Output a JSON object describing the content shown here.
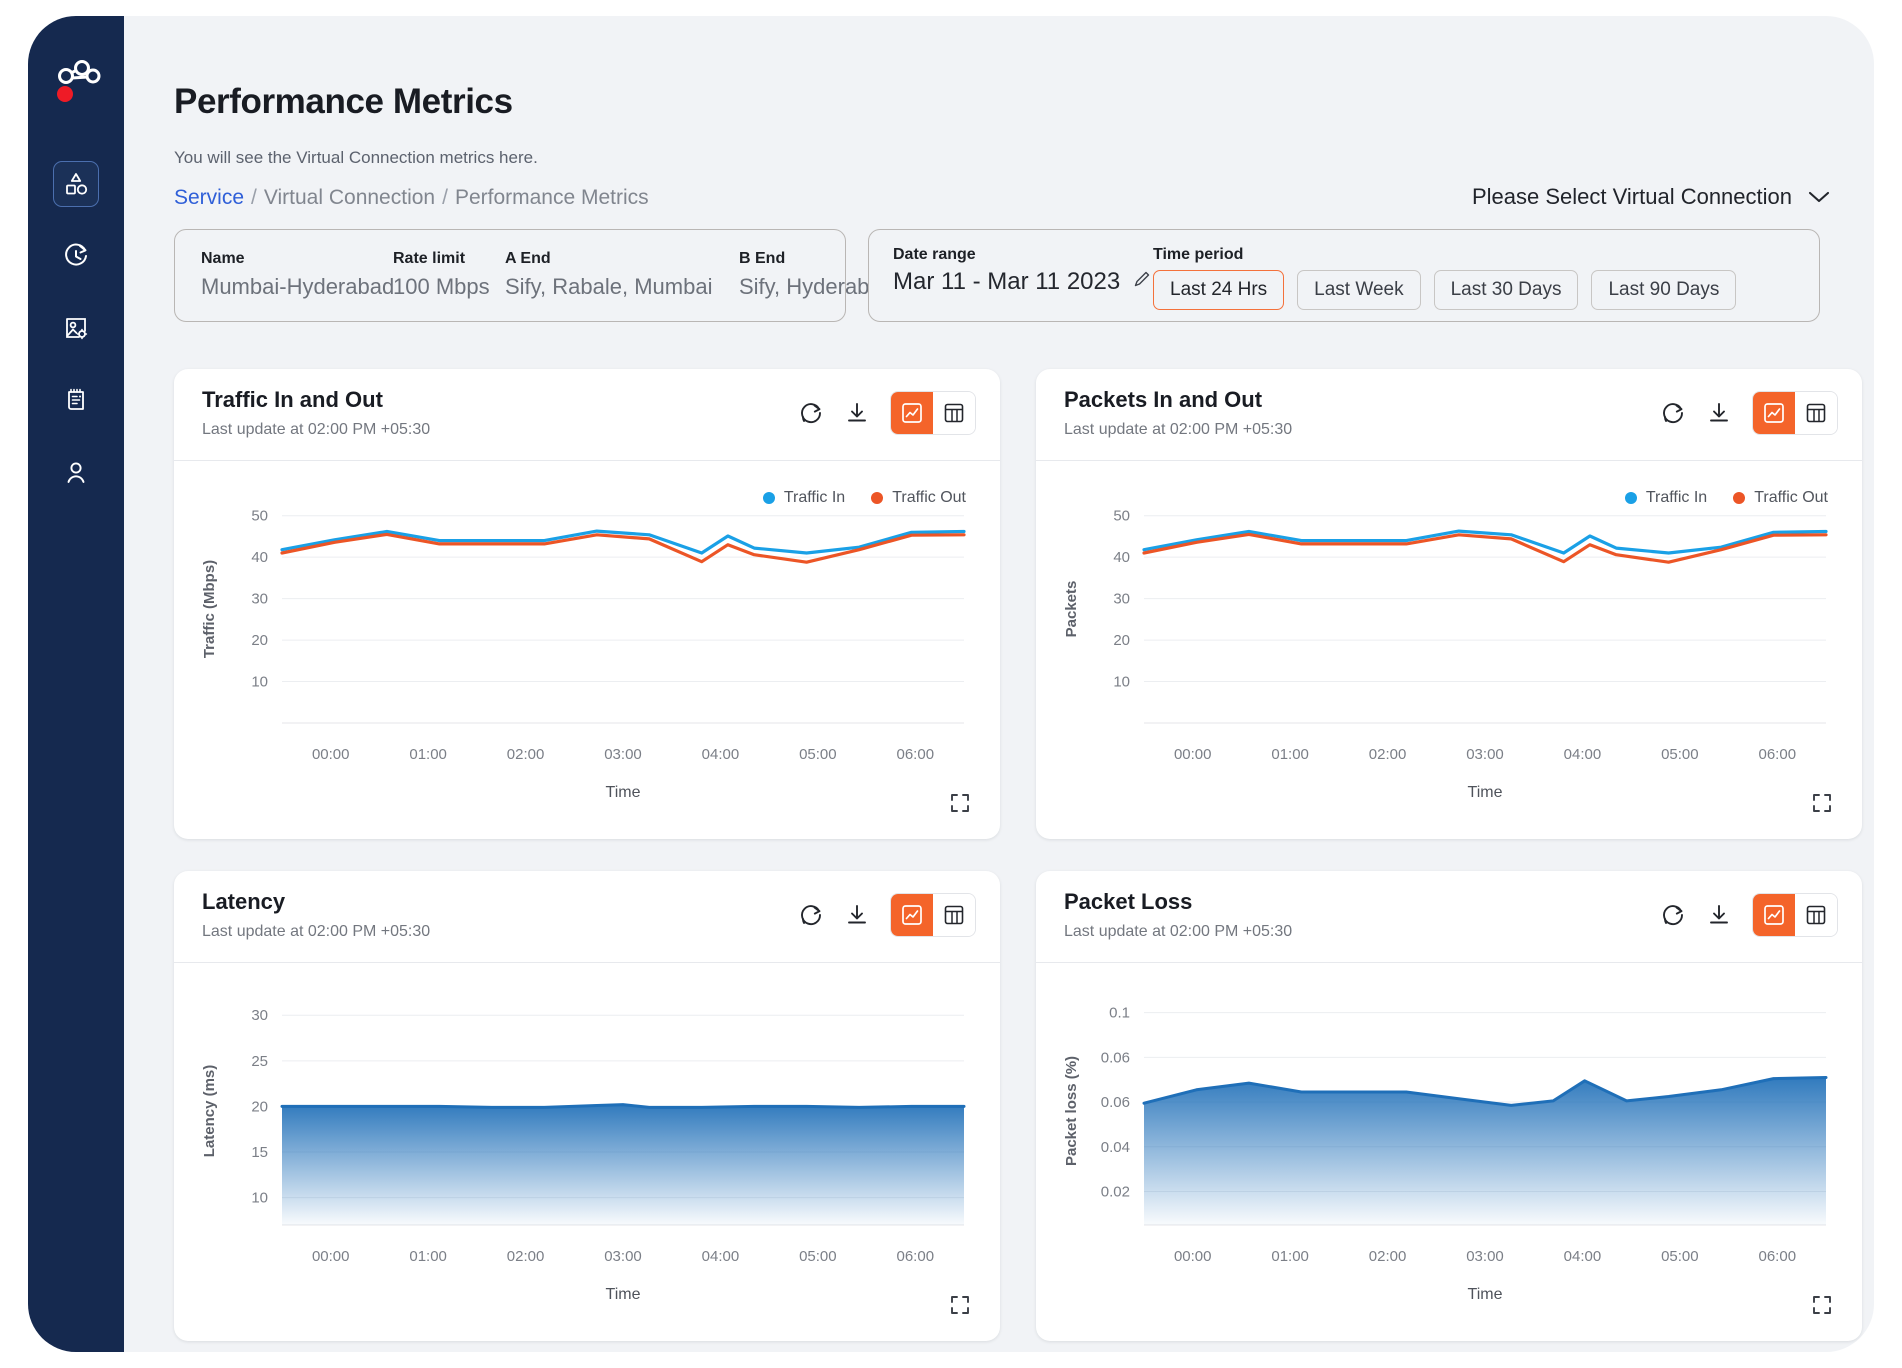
{
  "header": {
    "title": "Performance Metrics",
    "subtitle": "You will see the Virtual Connection metrics here.",
    "breadcrumb": {
      "link": "Service",
      "sep1": "/",
      "middle": "Virtual Connection",
      "sep2": "/",
      "current": "Performance Metrics"
    },
    "vc_selector_label": "Please Select Virtual Connection",
    "vc_selector_icon": "chevron-down-icon"
  },
  "sidebar": {
    "logo_icon": "network-nodes-logo",
    "items": [
      {
        "icon": "shapes-dashboard-icon",
        "active": true
      },
      {
        "icon": "clock-history-icon",
        "active": false
      },
      {
        "icon": "image-settings-icon",
        "active": false
      },
      {
        "icon": "invoice-document-icon",
        "active": false
      },
      {
        "icon": "user-profile-icon",
        "active": false
      }
    ]
  },
  "info_panel": {
    "fields": [
      {
        "label": "Name",
        "value": "Mumbai-Hyderabad"
      },
      {
        "label": "Rate limit",
        "value": "100 Mbps"
      },
      {
        "label": "A End",
        "value": "Sify, Rabale, Mumbai"
      },
      {
        "label": "B End",
        "value": "Sify, Hyderabad"
      }
    ]
  },
  "range_panel": {
    "date_range_label": "Date range",
    "date_range_value": "Mar 11 - Mar 11 2023",
    "edit_icon": "pencil-edit-icon",
    "time_period_label": "Time period",
    "periods": [
      {
        "label": "Last 24 Hrs",
        "selected": true
      },
      {
        "label": "Last Week",
        "selected": false
      },
      {
        "label": "Last 30 Days",
        "selected": false
      },
      {
        "label": "Last 90 Days",
        "selected": false
      }
    ]
  },
  "card_tools": {
    "refresh_icon": "refresh-icon",
    "download_icon": "download-icon",
    "chart_view_icon": "line-chart-icon",
    "table_view_icon": "table-grid-icon",
    "expand_icon": "expand-fullscreen-icon"
  },
  "colors": {
    "accent": "#f4642a",
    "traffic_in": "#1aa0e6",
    "traffic_out": "#ec5526",
    "area_line": "#1f6fb8",
    "sidebar": "#15294f",
    "link": "#2f5fd8"
  },
  "cards": [
    {
      "title": "Traffic In and Out",
      "subtitle": "Last update at 02:00 PM +05:30"
    },
    {
      "title": "Packets In and Out",
      "subtitle": "Last update at 02:00 PM +05:30"
    },
    {
      "title": "Latency",
      "subtitle": "Last update at 02:00 PM +05:30"
    },
    {
      "title": "Packet Loss",
      "subtitle": "Last update at 02:00 PM +05:30"
    }
  ],
  "chart_data": [
    {
      "id": "traffic",
      "type": "line",
      "title": "Traffic In and Out",
      "xlabel": "Time",
      "ylabel": "Traffic (Mbps)",
      "xticks": [
        "00:00",
        "01:00",
        "02:00",
        "03:00",
        "04:00",
        "05:00",
        "06:00"
      ],
      "yticks": [
        10,
        20,
        30,
        40,
        50
      ],
      "ylim": [
        0,
        55
      ],
      "grid": true,
      "legend_position": "top-right",
      "legend": [
        "Traffic In",
        "Traffic Out"
      ],
      "x": [
        0,
        0.5,
        1,
        1.5,
        2,
        2.5,
        3,
        3.5,
        4,
        4.25,
        4.5,
        5,
        5.5,
        6,
        6.5
      ],
      "series": [
        {
          "name": "Traffic In",
          "color": "#1aa0e6",
          "values": [
            41.8,
            44.2,
            46.2,
            44.0,
            44.0,
            44.0,
            46.3,
            45.4,
            41.0,
            45.1,
            42.2,
            41.0,
            42.4,
            46.0,
            46.2
          ]
        },
        {
          "name": "Traffic Out",
          "color": "#ec5526",
          "values": [
            41.0,
            43.6,
            45.5,
            43.2,
            43.2,
            43.2,
            45.4,
            44.4,
            38.9,
            43.0,
            40.6,
            38.8,
            41.8,
            45.3,
            45.4
          ]
        }
      ]
    },
    {
      "id": "packets",
      "type": "line",
      "title": "Packets In and Out",
      "xlabel": "Time",
      "ylabel": "Packets",
      "xticks": [
        "00:00",
        "01:00",
        "02:00",
        "03:00",
        "04:00",
        "05:00",
        "06:00"
      ],
      "yticks": [
        10,
        20,
        30,
        40,
        50
      ],
      "ylim": [
        0,
        55
      ],
      "grid": true,
      "legend_position": "top-right",
      "legend": [
        "Traffic In",
        "Traffic Out"
      ],
      "x": [
        0,
        0.5,
        1,
        1.5,
        2,
        2.5,
        3,
        3.5,
        4,
        4.25,
        4.5,
        5,
        5.5,
        6,
        6.5
      ],
      "series": [
        {
          "name": "Traffic In",
          "color": "#1aa0e6",
          "values": [
            41.8,
            44.2,
            46.2,
            44.0,
            44.0,
            44.0,
            46.3,
            45.4,
            41.0,
            45.1,
            42.2,
            41.0,
            42.4,
            46.0,
            46.2
          ]
        },
        {
          "name": "Traffic Out",
          "color": "#ec5526",
          "values": [
            41.0,
            43.6,
            45.5,
            43.2,
            43.2,
            43.2,
            45.4,
            44.4,
            38.9,
            43.0,
            40.6,
            38.8,
            41.8,
            45.3,
            45.4
          ]
        }
      ]
    },
    {
      "id": "latency",
      "type": "area",
      "title": "Latency",
      "xlabel": "Time",
      "ylabel": "Latency (ms)",
      "xticks": [
        "00:00",
        "01:00",
        "02:00",
        "03:00",
        "04:00",
        "05:00",
        "06:00"
      ],
      "yticks": [
        10,
        15,
        20,
        25,
        30
      ],
      "ylim": [
        7,
        32
      ],
      "grid": true,
      "legend_position": "none",
      "x": [
        0,
        0.5,
        1,
        1.5,
        2,
        2.5,
        3,
        3.25,
        3.5,
        4,
        4.5,
        5,
        5.5,
        6,
        6.5
      ],
      "series": [
        {
          "name": "Latency",
          "color": "#1f6fb8",
          "values": [
            20.0,
            20.0,
            20.0,
            20.0,
            19.9,
            19.9,
            20.1,
            20.2,
            19.9,
            19.9,
            20.0,
            20.0,
            19.9,
            20.0,
            20.0
          ]
        }
      ]
    },
    {
      "id": "packet-loss",
      "type": "area",
      "title": "Packet Loss",
      "xlabel": "Time",
      "ylabel": "Packet loss (%)",
      "xticks": [
        "00:00",
        "01:00",
        "02:00",
        "03:00",
        "04:00",
        "05:00",
        "06:00"
      ],
      "ytick_labels": [
        "0.02",
        "0.04",
        "0.06",
        "0.06",
        "0.1"
      ],
      "yticks": [
        0.02,
        0.04,
        0.06,
        0.08,
        0.1
      ],
      "ylim": [
        0.005,
        0.107
      ],
      "grid": true,
      "legend_position": "none",
      "x": [
        0,
        0.5,
        1,
        1.5,
        2,
        2.5,
        3,
        3.5,
        3.9,
        4.2,
        4.6,
        5,
        5.5,
        6,
        6.5
      ],
      "series": [
        {
          "name": "Packet loss",
          "color": "#1f6fb8",
          "values": [
            0.0595,
            0.0655,
            0.0685,
            0.0645,
            0.0645,
            0.0645,
            0.0615,
            0.0585,
            0.0605,
            0.0695,
            0.0605,
            0.0625,
            0.0655,
            0.0705,
            0.071
          ]
        }
      ]
    }
  ]
}
